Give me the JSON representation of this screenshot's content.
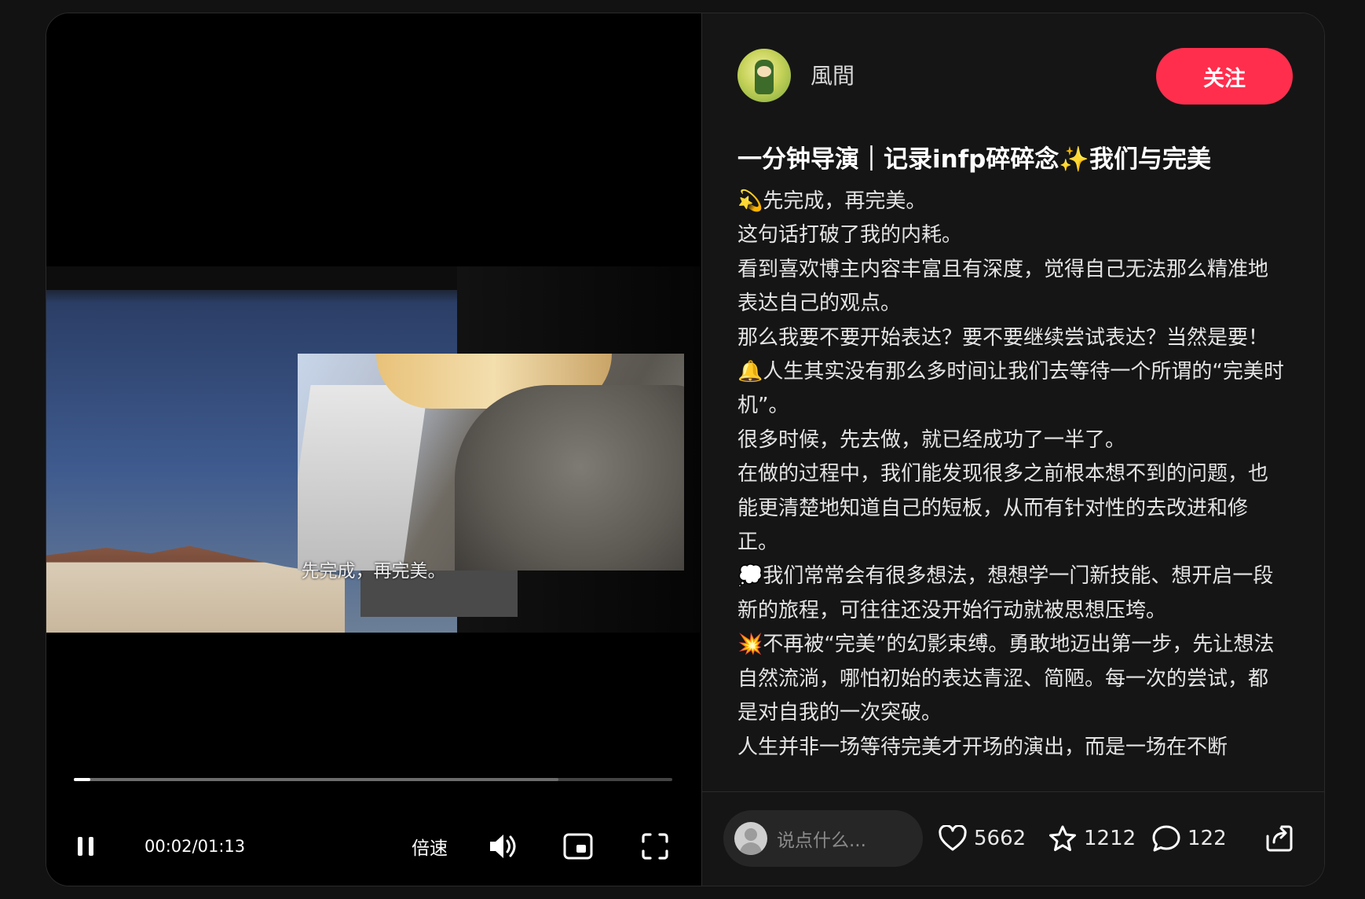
{
  "video": {
    "subtitle": "先完成，再完美。",
    "time": "00:02/01:13",
    "speed_label": "倍速",
    "progress": 0.027,
    "buffered": 0.81
  },
  "author": {
    "name": "風間",
    "follow_label": "关注"
  },
  "post": {
    "title": "一分钟导演｜记录infp碎碎念✨我们与完美",
    "lines": [
      "💫先完成，再完美。",
      "这句话打破了我的内耗。",
      "看到喜欢博主内容丰富且有深度，觉得自己无法那么精准地表达自己的观点。",
      "那么我要不要开始表达？要不要继续尝试表达？当然是要！",
      "🔔人生其实没有那么多时间让我们去等待一个所谓的“完美时机”。",
      "很多时候，先去做，就已经成功了一半了。",
      "在做的过程中，我们能发现很多之前根本想不到的问题，也能更清楚地知道自己的短板，从而有针对性的去改进和修正。",
      "💭我们常常会有很多想法，想想学一门新技能、想开启一段新的旅程，可往往还没开始行动就被思想压垮。",
      "💥不再被“完美”的幻影束缚。勇敢地迈出第一步，先让想法自然流淌，哪怕初始的表达青涩、简陋。每一次的尝试，都是对自我的一次突破。",
      "人生并非一场等待完美才开场的演出，而是一场在不断"
    ]
  },
  "engagement": {
    "comment_placeholder": "说点什么...",
    "likes": "5662",
    "favorites": "1212",
    "comments": "122"
  },
  "colors": {
    "accent": "#ff2e4d",
    "background": "#000000",
    "panel": "#151515"
  }
}
